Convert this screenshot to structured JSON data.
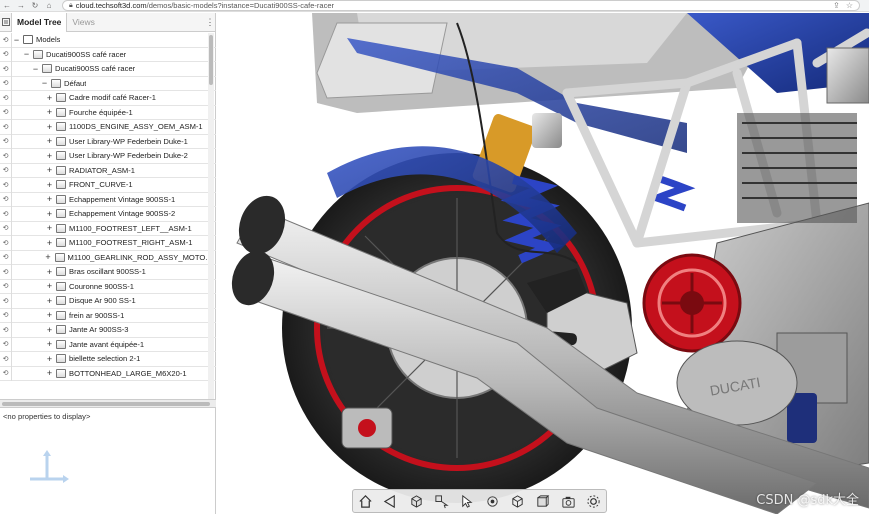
{
  "browser": {
    "url_host": "cloud.techsoft3d.com",
    "url_path": "/demos/basic-models?instance=Ducati900SS-cafe-racer"
  },
  "tabs": {
    "model_tree": "Model Tree",
    "views": "Views"
  },
  "tree": {
    "root": "Models",
    "model": "Ducati900SS café racer",
    "assembly": "Ducati900SS café racer",
    "config": "Défaut",
    "items": [
      "Cadre modif café Racer-1",
      "Fourche équipée-1",
      "1100DS_ENGINE_ASSY_OEM_ASM-1",
      "User Library-WP Federbein Duke-1",
      "User Library-WP Federbein Duke-2",
      "RADIATOR_ASM-1",
      "FRONT_CURVE-1",
      "Echappement Vintage 900SS-1",
      "Echappement Vintage 900SS-2",
      "M1100_FOOTREST_LEFT__ASM-1",
      "M1100_FOOTREST_RIGHT_ASM-1",
      "M1100_GEARLINK_ROD_ASSY_MOTOCO...",
      "Bras oscillant 900SS-1",
      "Couronne 900SS-1",
      "Disque Ar 900 SS-1",
      "frein ar 900SS-1",
      "Jante Ar 900SS-3",
      "Jante avant équipée-1",
      "biellette selection 2-1",
      "BOTTONHEAD_LARGE_M6X20-1"
    ]
  },
  "properties": {
    "empty_text": "<no properties to display>"
  },
  "toolbar": {
    "buttons": [
      "home-icon",
      "camera-view-icon",
      "cube-draw-mode-icon",
      "select-tool-icon",
      "pointer-icon",
      "explode-icon",
      "cube-icon",
      "cube-face-icon",
      "snapshot-icon",
      "settings-icon"
    ]
  },
  "watermark": "CSDN @sdk大全"
}
